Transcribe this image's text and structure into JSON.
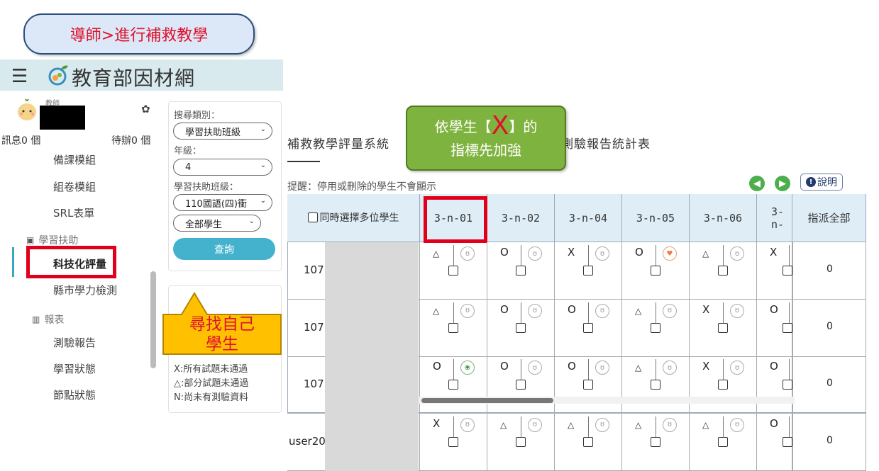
{
  "callouts": {
    "top": "導師>進行補救教學",
    "green_line1_pre": "依學生【",
    "green_line1_x": "X",
    "green_line1_post": "】的",
    "green_line2": "指標先加強",
    "yellow": "尋找自己學生"
  },
  "header": {
    "brand": "教育部因材網",
    "menu_icon": "hamburger-icon",
    "logo_icon": "leaf-logo-icon"
  },
  "user": {
    "role": "教師",
    "messages": "訊息0 個",
    "todos": "待辦0 個",
    "settings_icon": "gear-icon"
  },
  "sidebar": {
    "items": [
      {
        "label": "備課模組"
      },
      {
        "label": "組卷模組"
      },
      {
        "label": "SRL表單"
      },
      {
        "label": "學習扶助",
        "group": true
      },
      {
        "label": "科技化評量",
        "selected": true
      },
      {
        "label": "縣市學力檢測"
      },
      {
        "label": "報表",
        "group": true
      },
      {
        "label": "測驗報告"
      },
      {
        "label": "學習狀態"
      },
      {
        "label": "節點狀態"
      }
    ]
  },
  "filter": {
    "search_type_label": "搜尋類別：",
    "search_type_value": "學習扶助班級",
    "grade_label": "年級：",
    "grade_value": "4",
    "class_label": "學習扶助班級：",
    "class_value": "110國語(四)衝",
    "student_value": "全部學生",
    "query_button": "查詢"
  },
  "legend": [
    "X:所有試題未通過",
    "△:部分試題未通過",
    "N:尚未有測驗資料"
  ],
  "main": {
    "title_left": "補救教學評量系統",
    "title_right": "生測驗報告統計表",
    "hint": "提醒：停用或刪除的學生不會顯示",
    "help_label": "說明"
  },
  "table": {
    "select_multi_label": "同時選擇多位學生",
    "columns": [
      "3-n-01",
      "3-n-02",
      "3-n-04",
      "3-n-05",
      "3-n-06",
      "3-n-"
    ],
    "assign_all_label": "指派全部",
    "rows": [
      {
        "id": "107",
        "marks": [
          "△",
          "O",
          "X",
          "O",
          "△",
          "X"
        ],
        "assign": "0"
      },
      {
        "id": "107",
        "marks": [
          "△",
          "O",
          "O",
          "△",
          "X",
          "O"
        ],
        "assign": "0"
      },
      {
        "id": "107",
        "marks": [
          "O",
          "O",
          "O",
          "△",
          "X",
          "O"
        ],
        "assign": "0"
      },
      {
        "id": "user20",
        "marks": [
          "X",
          "△",
          "△",
          "△",
          "△",
          "O"
        ],
        "assign": "0"
      }
    ]
  }
}
